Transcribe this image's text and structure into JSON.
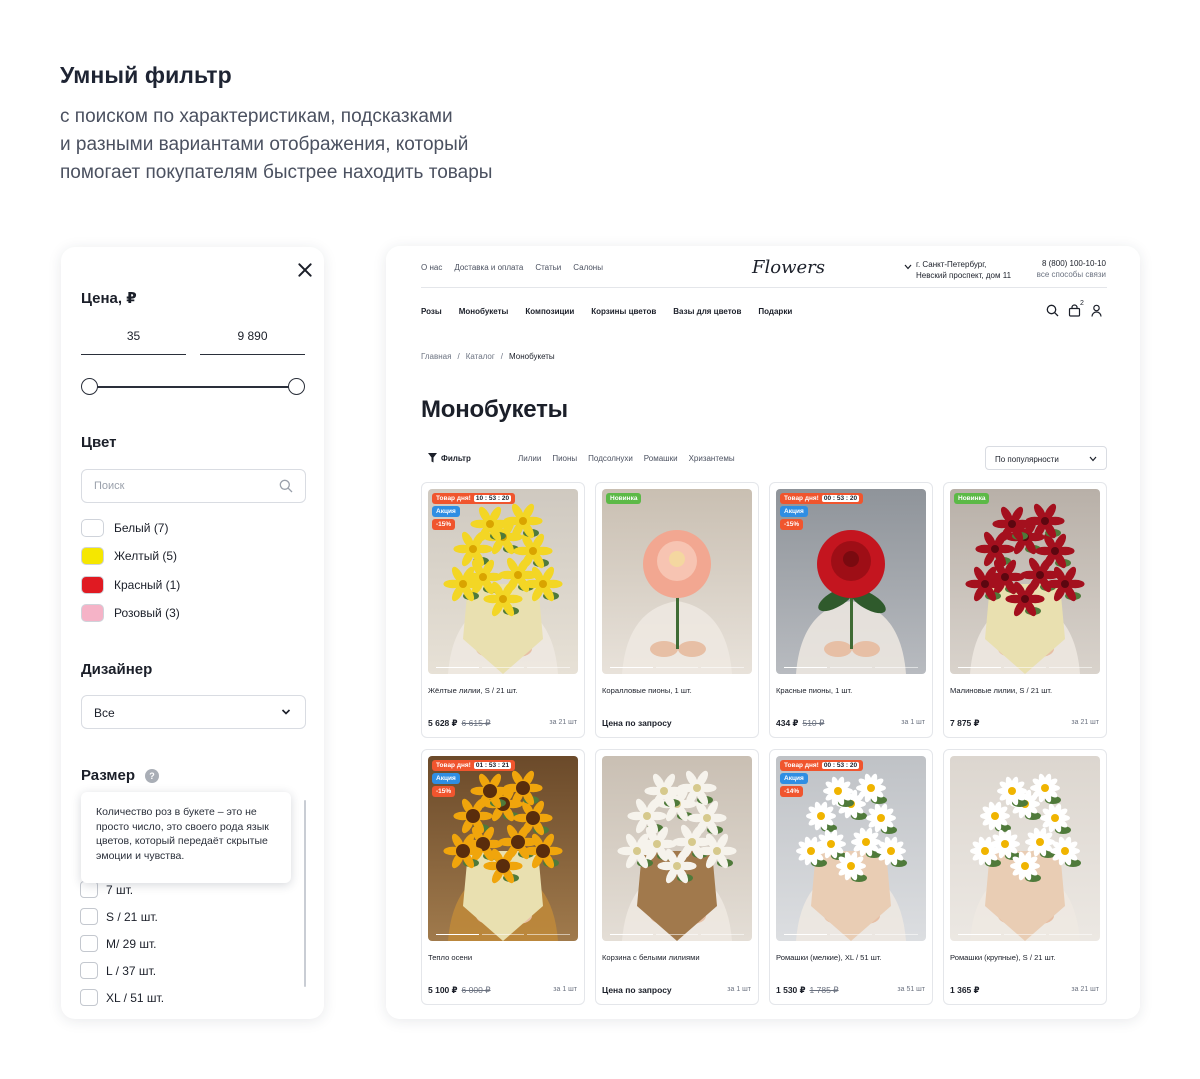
{
  "intro": {
    "title": "Умный фильтр",
    "line1": "с поиском по характеристикам, подсказками",
    "line2": "и разными вариантами отображения, который",
    "line3": "помогает покупателям быстрее находить товары"
  },
  "filter": {
    "price_title": "Цена, ₽",
    "price_min": "35",
    "price_max": "9 890",
    "color_title": "Цвет",
    "search_placeholder": "Поиск",
    "colors": [
      {
        "label": "Белый (7)",
        "hex": "#ffffff"
      },
      {
        "label": "Желтый (5)",
        "hex": "#f5e700"
      },
      {
        "label": "Красный (1)",
        "hex": "#e01a22"
      },
      {
        "label": "Розовый (3)",
        "hex": "#f5b3c7"
      }
    ],
    "designer_title": "Дизайнер",
    "designer_value": "Все",
    "size_title": "Размер",
    "help_glyph": "?",
    "tooltip": "Количество роз в букете – это не просто число, это своего рода язык цветов, который передаёт скрытые эмоции и чувства.",
    "sizes": [
      "7 шт.",
      "S / 21 шт.",
      "M/ 29 шт.",
      "L / 37 шт.",
      "XL / 51 шт."
    ]
  },
  "header": {
    "top_links": [
      "О нас",
      "Доставка и оплата",
      "Статьи",
      "Салоны"
    ],
    "logo": "Flowers",
    "address_line1": "г. Санкт-Петербург,",
    "address_line2": "Невский проспект, дом 11",
    "phone": "8 (800) 100-10-10",
    "phone_sub": "все способы связи",
    "nav": [
      "Розы",
      "Монобукеты",
      "Композиции",
      "Корзины цветов",
      "Вазы для цветов",
      "Подарки"
    ],
    "cart_count": "2"
  },
  "breadcrumbs": [
    "Главная",
    "Каталог",
    "Монобукеты"
  ],
  "page_title": "Монобукеты",
  "filter_button": "Фильтр",
  "quick_filters": [
    "Лилии",
    "Пионы",
    "Подсолнухи",
    "Ромашки",
    "Хризантемы"
  ],
  "sort_value": "По популярности",
  "badge_labels": {
    "deal": "Товар дня!",
    "promo": "Акция",
    "new": "Новинка"
  },
  "products": [
    {
      "name": "Жёлтые лилии, S / 21 шт.",
      "price": "5 628 ₽",
      "old_price": "6 615 ₽",
      "per": "за 21 шт",
      "deal_timer": "10 : 53 : 20",
      "promo": true,
      "discount": "-15%",
      "new": false
    },
    {
      "name": "Коралловые пионы, 1 шт.",
      "price": "Цена по запросу",
      "old_price": "",
      "per": "",
      "deal_timer": "",
      "promo": false,
      "discount": "",
      "new": true
    },
    {
      "name": "Красные пионы, 1 шт.",
      "price": "434 ₽",
      "old_price": "510 ₽",
      "per": "за 1 шт",
      "deal_timer": "00 : 53 : 20",
      "promo": true,
      "discount": "-15%",
      "new": false
    },
    {
      "name": "Малиновые лилии, S / 21 шт.",
      "price": "7 875 ₽",
      "old_price": "",
      "per": "за 21 шт",
      "deal_timer": "",
      "promo": false,
      "discount": "",
      "new": true
    },
    {
      "name": "Тепло осени",
      "price": "5 100 ₽",
      "old_price": "6 000 ₽",
      "per": "за 1 шт",
      "deal_timer": "01 : 53 : 21",
      "promo": true,
      "discount": "-15%",
      "new": false
    },
    {
      "name": "Корзина с белыми лилиями",
      "price": "Цена по запросу",
      "old_price": "",
      "per": "за 1 шт",
      "deal_timer": "",
      "promo": false,
      "discount": "",
      "new": false
    },
    {
      "name": "Ромашки (мелкие), XL / 51 шт.",
      "price": "1 530 ₽",
      "old_price": "1 785 ₽",
      "per": "за 51 шт",
      "deal_timer": "00 : 53 : 20",
      "promo": true,
      "discount": "-14%",
      "new": false
    },
    {
      "name": "Ромашки (крупные), S / 21 шт.",
      "price": "1 365 ₽",
      "old_price": "",
      "per": "за 21 шт",
      "deal_timer": "",
      "promo": false,
      "discount": "",
      "new": false
    }
  ]
}
